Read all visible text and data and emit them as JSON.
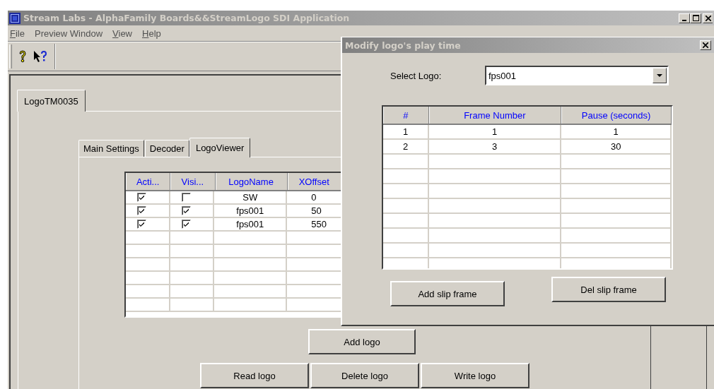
{
  "window": {
    "title": "Stream Labs  - AlphaFamily Boards&&StreamLogo SDI Application"
  },
  "menu": [
    {
      "label": "File",
      "underline_first": true
    },
    {
      "label": "Preview Window",
      "underline_first": false
    },
    {
      "label": "View",
      "underline_first": true
    },
    {
      "label": "Help",
      "underline_first": true
    }
  ],
  "tabs": [
    {
      "label": "LogoTM0035",
      "selected": true
    }
  ],
  "subtabs": [
    {
      "label": "Main Settings",
      "selected": false
    },
    {
      "label": "Decoder",
      "selected": false
    },
    {
      "label": "LogoViewer",
      "selected": true
    }
  ],
  "logo_table": {
    "columns": [
      "Acti...",
      "Visi...",
      "LogoName",
      "XOffset"
    ],
    "rows": [
      {
        "active": true,
        "visible": false,
        "name": "SW",
        "xoffset": "0"
      },
      {
        "active": true,
        "visible": true,
        "name": "fps001",
        "xoffset": "50"
      },
      {
        "active": true,
        "visible": true,
        "name": "fps001",
        "xoffset": "550"
      }
    ]
  },
  "buttons": {
    "add": "Add logo",
    "read": "Read logo",
    "delete": "Delete logo",
    "write": "Write logo"
  },
  "dialog": {
    "title": "Modify logo's play time",
    "select_label": "Select Logo:",
    "select_value": "fps001",
    "columns": [
      "#",
      "Frame Number",
      "Pause (seconds)"
    ],
    "rows": [
      [
        "1",
        "1",
        "1"
      ],
      [
        "2",
        "3",
        "30"
      ]
    ],
    "buttons": [
      "Add slip frame",
      "Del slip frame"
    ]
  }
}
